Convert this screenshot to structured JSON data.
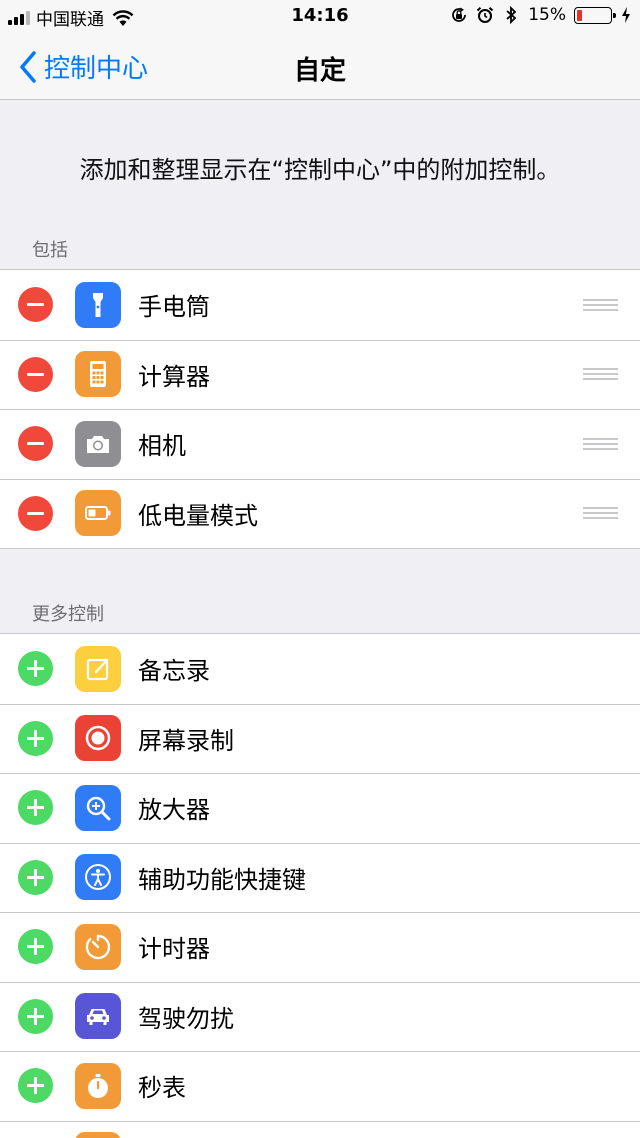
{
  "status_bar": {
    "carrier": "中国联通",
    "time": "14:16",
    "battery_percent_label": "15%",
    "battery_level": 0.15,
    "battery_color": "#e0342c"
  },
  "nav": {
    "back_label": "控制中心",
    "title": "自定",
    "accent": "#007aff"
  },
  "description": "添加和整理显示在“控制中心”中的附加控制。",
  "included": {
    "header": "包括",
    "items": [
      {
        "label": "手电筒",
        "icon": "flashlight-icon",
        "color": "#2f7cf6"
      },
      {
        "label": "计算器",
        "icon": "calculator-icon",
        "color": "#f29a38"
      },
      {
        "label": "相机",
        "icon": "camera-icon",
        "color": "#8e8e93"
      },
      {
        "label": "低电量模式",
        "icon": "low-power-battery-icon",
        "color": "#f29a38"
      }
    ]
  },
  "more": {
    "header": "更多控制",
    "items": [
      {
        "label": "备忘录",
        "icon": "notes-icon",
        "color": "#fccf3e"
      },
      {
        "label": "屏幕录制",
        "icon": "screen-record-icon",
        "color": "#ea4335"
      },
      {
        "label": "放大器",
        "icon": "magnifier-icon",
        "color": "#2f7cf6"
      },
      {
        "label": "辅助功能快捷键",
        "icon": "accessibility-icon",
        "color": "#2f7cf6"
      },
      {
        "label": "计时器",
        "icon": "timer-icon",
        "color": "#f29a38"
      },
      {
        "label": "驾驶勿扰",
        "icon": "car-icon",
        "color": "#5856d6"
      },
      {
        "label": "秒表",
        "icon": "stopwatch-icon",
        "color": "#f29a38"
      }
    ]
  },
  "colors": {
    "remove": "#f0493c",
    "add": "#4cd964",
    "background": "#efeff4"
  }
}
